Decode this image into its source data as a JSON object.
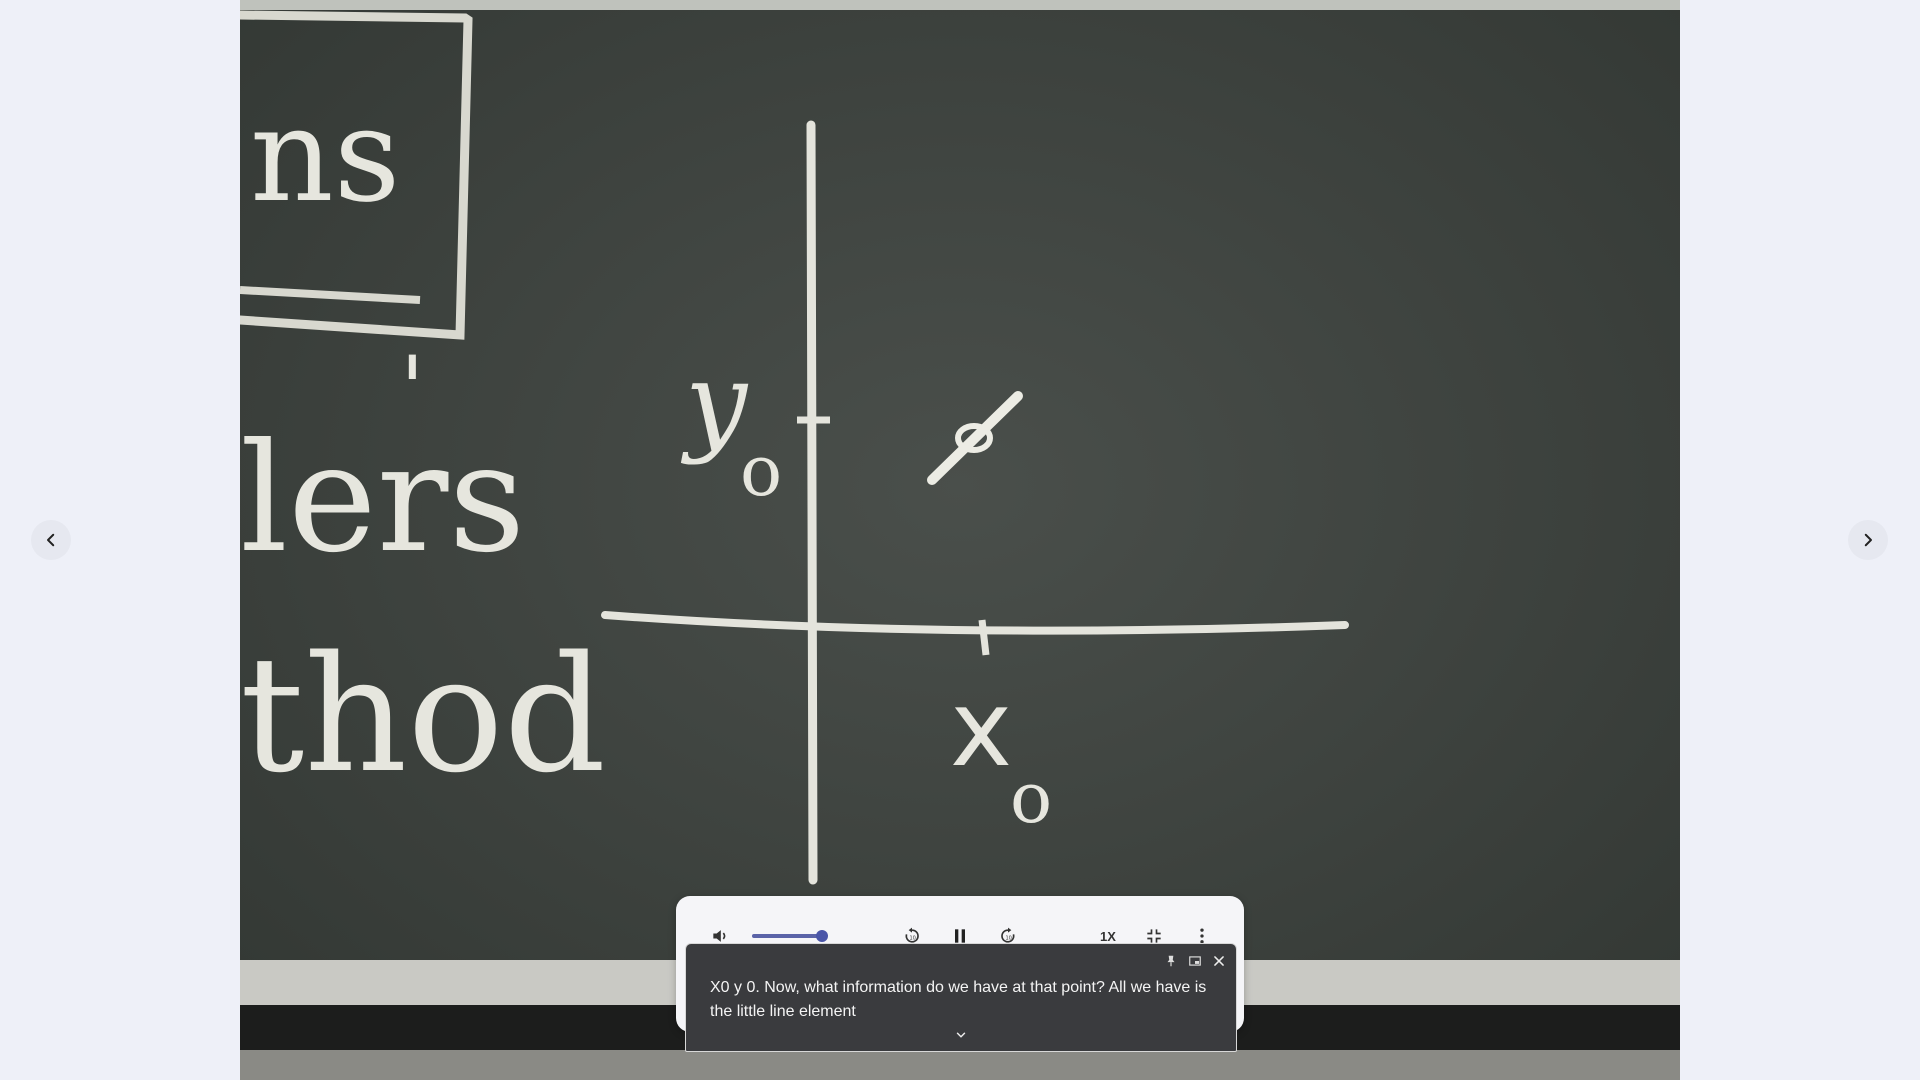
{
  "navigation": {
    "prev_icon": "chevron-left-icon",
    "next_icon": "chevron-right-icon"
  },
  "video": {
    "board_text": {
      "box_word": "ns",
      "line1": "lers",
      "line2": "thod",
      "apostrophe": "'",
      "y_label": "y",
      "y_sub": "o",
      "x_label": "x",
      "x_sub": "o"
    }
  },
  "controls": {
    "volume_icon": "volume-icon",
    "volume_level": 0.9,
    "rewind_icon": "rewind-10-icon",
    "pause_icon": "pause-icon",
    "forward_icon": "forward-10-icon",
    "speed_label": "1X",
    "exit_fullscreen_icon": "exit-fullscreen-icon",
    "more_icon": "more-vert-icon"
  },
  "captions": {
    "text": "X0 y 0. Now, what information do we have at that point? All we have is the little line element",
    "pin_icon": "pin-icon",
    "popout_icon": "picture-in-picture-icon",
    "close_icon": "close-icon",
    "expand_icon": "chevron-down-icon"
  },
  "colors": {
    "page_bg": "#eef0f8",
    "board": "#3b403c",
    "accent": "#4a55a8",
    "caption_bg": "#3a3b3e"
  }
}
